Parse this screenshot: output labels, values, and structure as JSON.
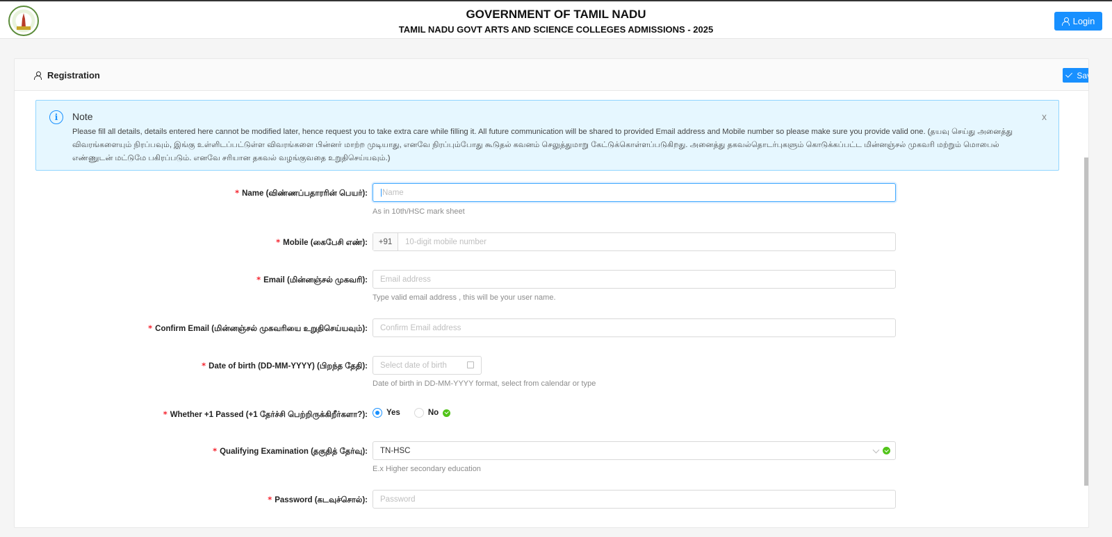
{
  "header": {
    "title": "GOVERNMENT OF TAMIL NADU",
    "subtitle": "TAMIL NADU GOVT ARTS AND SCIENCE COLLEGES ADMISSIONS - 2025",
    "login_label": "Login"
  },
  "card": {
    "title": "Registration",
    "save_label": "Save"
  },
  "note": {
    "title": "Note",
    "text": "Please fill all details, details entered here cannot be modified later, hence request you to take extra care while filling it. All future communication will be shared to provided Email address and Mobile number so please make sure you provide valid one. (தயவு செய்து அனைத்து விவரங்களையும் நிரப்பவும், இங்கு உள்ளிடப்பட்டுள்ள விவரங்களை பின்னர் மாற்ற முடியாது, எனவே நிரப்பும்போது கூடுதல் கவனம் செலுத்துமாறு கேட்டுக்கொள்ளப்படுகிறது. அனைத்து தகவல்தொடர்புகளும் கொடுக்கப்பட்ட மின்னஞ்சல் முகவரி மற்றும் மொபைல் எண்ணுடன் மட்டுமே பகிரப்படும். எனவே சரியான தகவல் வழங்குவதை உறுதிசெய்யவும்.)",
    "close": "x"
  },
  "form": {
    "required_mark": "*",
    "name": {
      "label": "Name (விண்ணப்பதாரரின் பெயர்):",
      "placeholder": "Name",
      "help": "As in 10th/HSC mark sheet"
    },
    "mobile": {
      "label": "Mobile (கைபேசி எண்):",
      "prefix": "+91",
      "placeholder": "10-digit mobile number"
    },
    "email": {
      "label": "Email (மின்னஞ்சல் முகவரி):",
      "placeholder": "Email address",
      "help": "Type valid email address , this will be your user name."
    },
    "confirm_email": {
      "label": "Confirm Email (மின்னஞ்சல் முகவரியை உறுதிசெய்யவும்):",
      "placeholder": "Confirm Email address"
    },
    "dob": {
      "label": "Date of birth (DD-MM-YYYY) (பிறந்த தேதி):",
      "placeholder": "Select date of birth",
      "help": "Date of birth in DD-MM-YYYY format, select from calendar or type"
    },
    "plus_one": {
      "label": "Whether +1 Passed (+1 தேர்ச்சி பெற்றிருக்கிறீர்களா?):",
      "yes": "Yes",
      "no": "No",
      "selected": "Yes"
    },
    "qualifying": {
      "label": "Qualifying Examination (தகுதித் தேர்வு):",
      "value": "TN-HSC",
      "help": "E.x Higher secondary education"
    },
    "password": {
      "label": "Password (கடவுச்சொல்):",
      "placeholder": "Password"
    }
  }
}
